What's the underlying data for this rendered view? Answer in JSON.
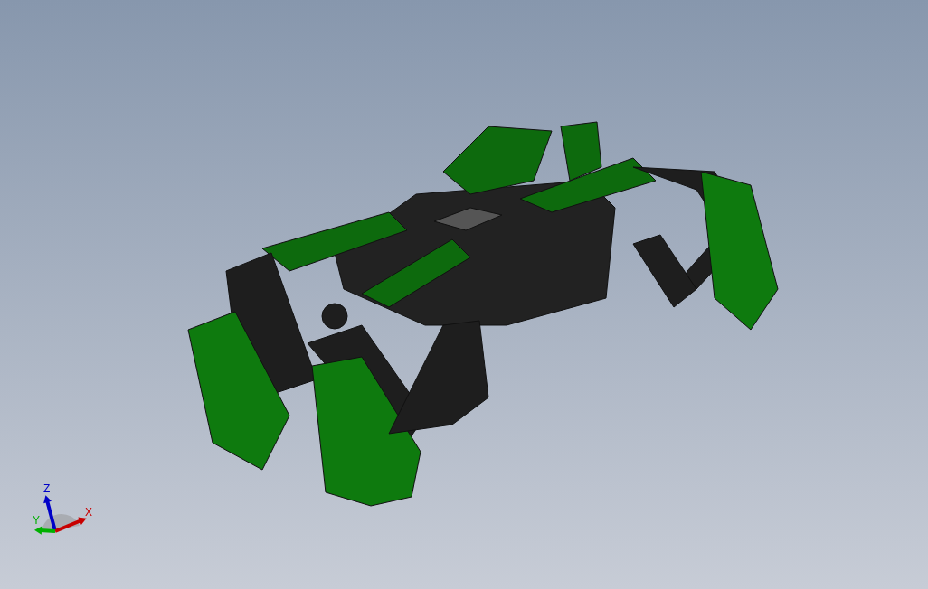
{
  "viewport": {
    "triad": {
      "axes": [
        {
          "kind": "z",
          "label": "Z",
          "color": "#0000c8"
        },
        {
          "kind": "x",
          "label": "X",
          "color": "#c80000"
        },
        {
          "kind": "y",
          "label": "Y",
          "color": "#00b000"
        }
      ]
    }
  }
}
